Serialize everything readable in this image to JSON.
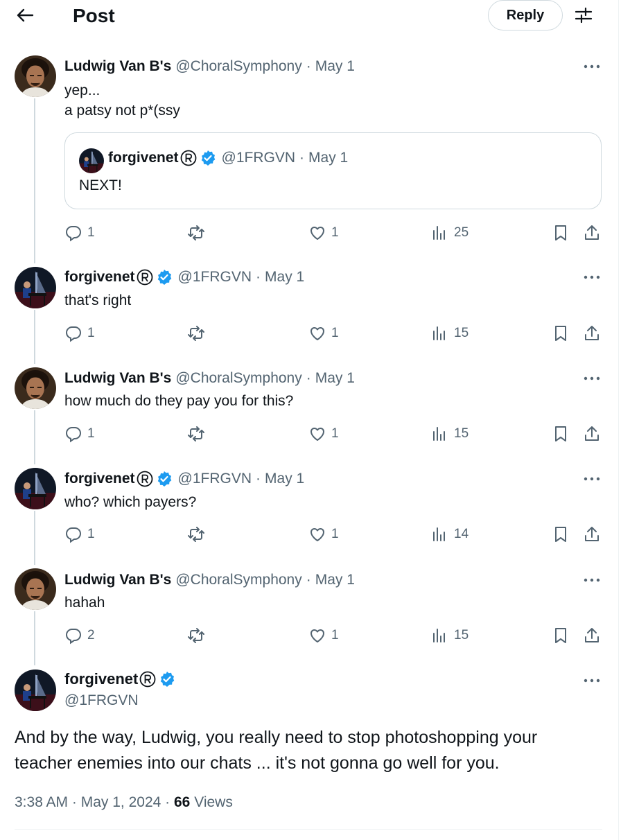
{
  "header": {
    "title": "Post",
    "reply_button": "Reply"
  },
  "colors": {
    "verified": "#1d9bf0",
    "secondary_text": "#536471",
    "border": "#cfd9de"
  },
  "replies": [
    {
      "name": "Ludwig Van B's",
      "handle": "@ChoralSymphony",
      "date": "May 1",
      "body": "yep...\na patsy not p*(ssy",
      "quote": {
        "name": "forgivenet",
        "handle": "@1FRGVN",
        "date": "May 1",
        "body": "NEXT!"
      },
      "replies": "1",
      "likes": "1",
      "views": "25"
    },
    {
      "name": "forgivenet",
      "handle": "@1FRGVN",
      "date": "May 1",
      "body": "that's right",
      "replies": "1",
      "likes": "1",
      "views": "15"
    },
    {
      "name": "Ludwig Van B's",
      "handle": "@ChoralSymphony",
      "date": "May 1",
      "body": "how much do they pay you for this?",
      "replies": "1",
      "likes": "1",
      "views": "15"
    },
    {
      "name": "forgivenet",
      "handle": "@1FRGVN",
      "date": "May 1",
      "body": "who? which payers?",
      "replies": "1",
      "likes": "1",
      "views": "14"
    },
    {
      "name": "Ludwig Van B's",
      "handle": "@ChoralSymphony",
      "date": "May 1",
      "body": "hahah",
      "replies": "2",
      "likes": "1",
      "views": "15"
    }
  ],
  "main": {
    "name": "forgivenet",
    "handle": "@1FRGVN",
    "body": "And by the way, Ludwig, you really need to stop photoshopping your teacher enemies into our chats ... it's not gonna go well for you.",
    "time": "3:38 AM",
    "date": "May 1, 2024",
    "views_count": "66",
    "views_label": "Views"
  },
  "icons": [
    "back-arrow-icon",
    "filter-icon",
    "more-icon",
    "reply-icon",
    "repost-icon",
    "like-icon",
    "views-icon",
    "bookmark-icon",
    "share-icon",
    "verified-badge-icon",
    "registered-icon"
  ]
}
